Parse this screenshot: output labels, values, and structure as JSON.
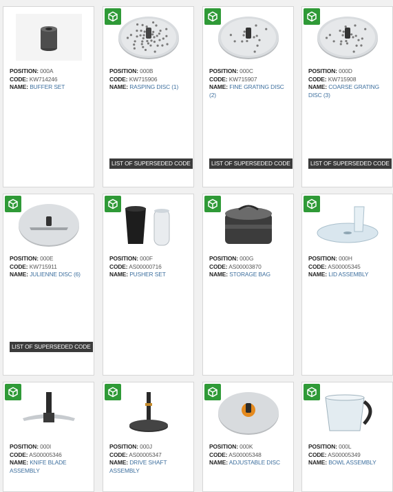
{
  "labels": {
    "position": "POSITION:",
    "code": "CODE:",
    "name": "NAME:",
    "superseded": "LIST OF SUPERSEDED CODE"
  },
  "products": [
    {
      "position": "000A",
      "code": "KW714246",
      "name": "BUFFER SET",
      "badge": false,
      "superseded": false,
      "image": "buffer-set-image"
    },
    {
      "position": "000B",
      "code": "KW715906",
      "name": "RASPING DISC (1)",
      "badge": true,
      "superseded": true,
      "image": "rasping-disc-image"
    },
    {
      "position": "000C",
      "code": "KW715907",
      "name": "FINE GRATING DISC (2)",
      "badge": true,
      "superseded": true,
      "image": "fine-grating-disc-image"
    },
    {
      "position": "000D",
      "code": "KW715908",
      "name": "COARSE GRATING DISC (3)",
      "badge": true,
      "superseded": true,
      "image": "coarse-grating-disc-image"
    },
    {
      "position": "000E",
      "code": "KW715911",
      "name": "JULIENNE DISC (6)",
      "badge": true,
      "superseded": true,
      "image": "julienne-disc-image"
    },
    {
      "position": "000F",
      "code": "AS00000716",
      "name": "PUSHER SET",
      "badge": true,
      "superseded": false,
      "image": "pusher-set-image"
    },
    {
      "position": "000G",
      "code": "AS00003870",
      "name": "STORAGE BAG",
      "badge": true,
      "superseded": false,
      "image": "storage-bag-image"
    },
    {
      "position": "000H",
      "code": "AS00005345",
      "name": "LID ASSEMBLY",
      "badge": true,
      "superseded": false,
      "image": "lid-assembly-image"
    },
    {
      "position": "000I",
      "code": "AS00005346",
      "name": "KNIFE BLADE ASSEMBLY",
      "badge": true,
      "superseded": false,
      "image": "knife-blade-image"
    },
    {
      "position": "000J",
      "code": "AS00005347",
      "name": "DRIVE SHAFT ASSEMBLY",
      "badge": true,
      "superseded": false,
      "image": "drive-shaft-image"
    },
    {
      "position": "000K",
      "code": "AS00005348",
      "name": "ADJUSTABLE DISC",
      "badge": true,
      "superseded": false,
      "image": "adjustable-disc-image"
    },
    {
      "position": "000L",
      "code": "AS00005349",
      "name": "BOWL ASSEMBLY",
      "badge": true,
      "superseded": false,
      "image": "bowl-assembly-image"
    }
  ],
  "colors": {
    "badge": "#2f9a37",
    "link": "#3d6f9e",
    "button": "#3b3b3b"
  }
}
